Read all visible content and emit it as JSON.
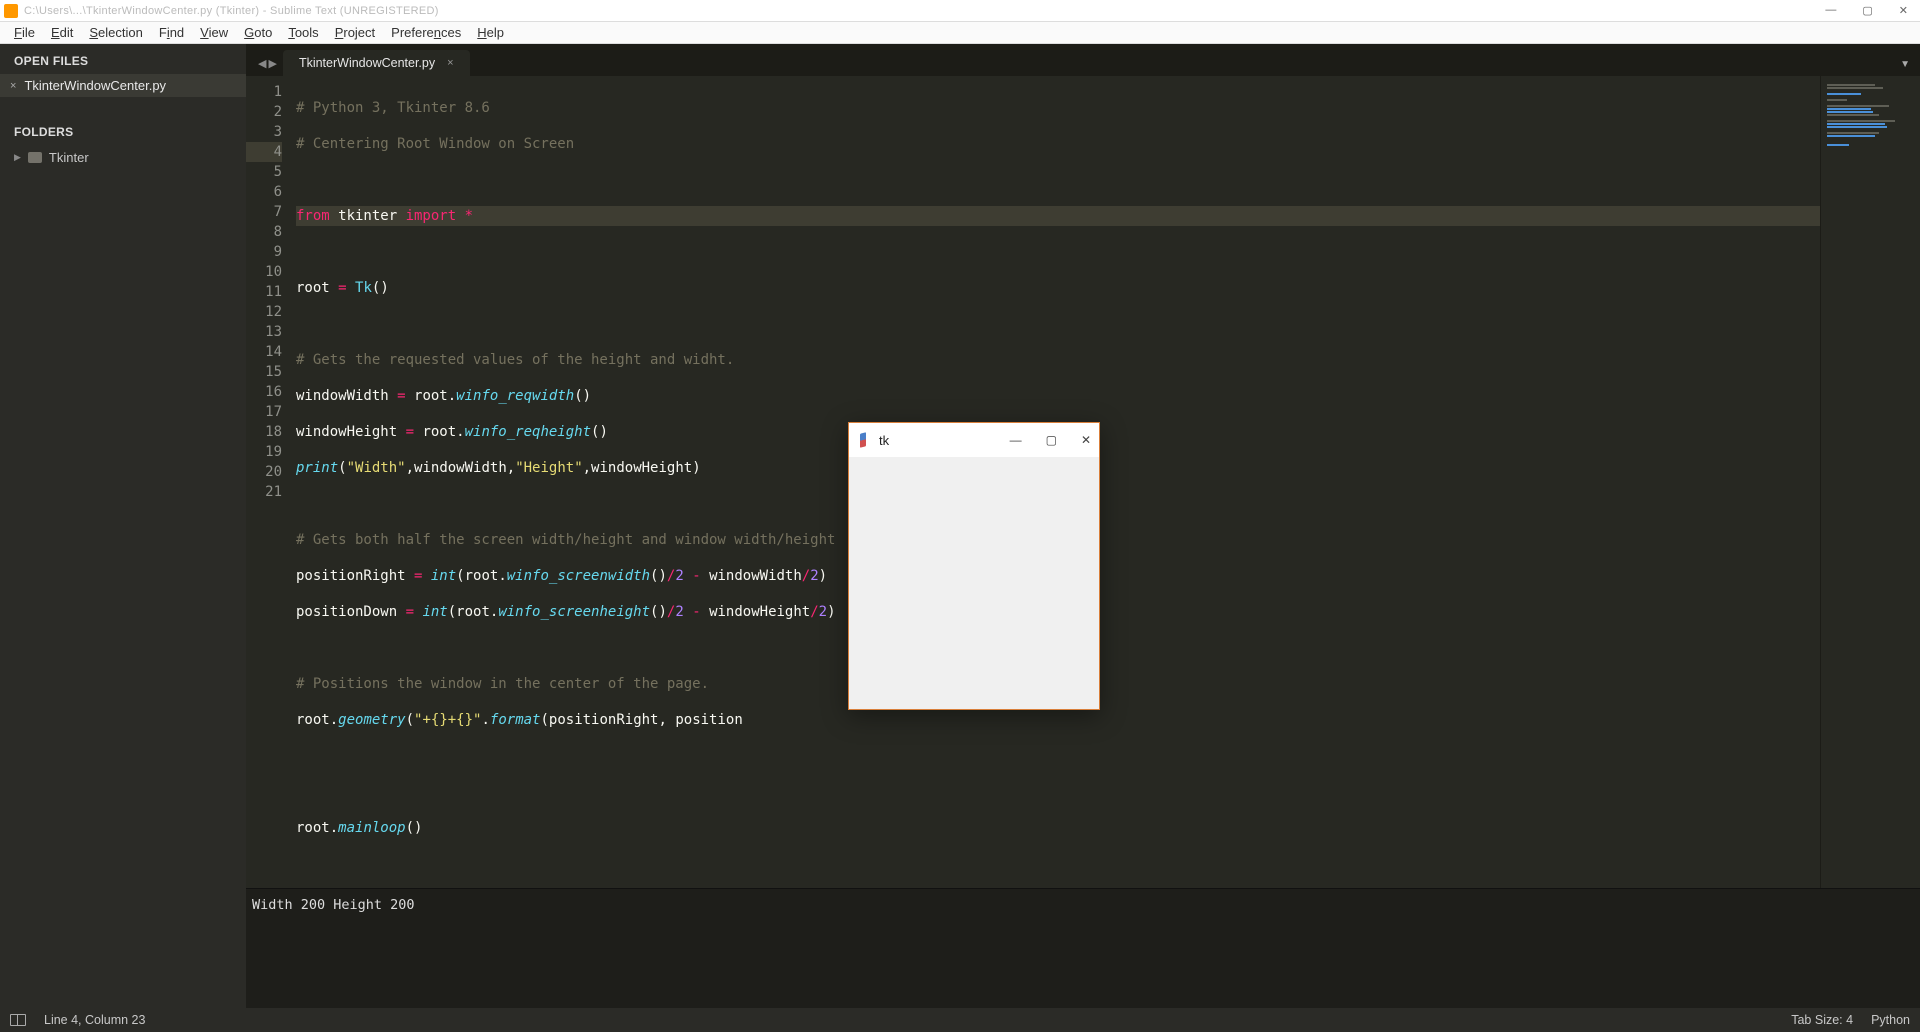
{
  "window": {
    "title": "C:\\Users\\...\\TkinterWindowCenter.py (Tkinter) - Sublime Text (UNREGISTERED)"
  },
  "menus": [
    "File",
    "Edit",
    "Selection",
    "Find",
    "View",
    "Goto",
    "Tools",
    "Project",
    "Preferences",
    "Help"
  ],
  "sidebar": {
    "open_files_hdr": "OPEN FILES",
    "open_file": {
      "name": "TkinterWindowCenter.py"
    },
    "folders_hdr": "FOLDERS",
    "folder": {
      "name": "Tkinter"
    }
  },
  "tab": {
    "label": "TkinterWindowCenter.py"
  },
  "gutter": {
    "count": 21,
    "highlight": 4
  },
  "code": {
    "l1": "# Python 3, Tkinter 8.6",
    "l2": "# Centering Root Window on Screen",
    "l4_from": "from",
    "l4_tk": " tkinter ",
    "l4_import": "import",
    "l4_star": " *",
    "l6_root": "root ",
    "l6_eq": "=",
    "l6_tk": " Tk",
    "l6_par": "()",
    "l8": "# Gets the requested values of the height and widht.",
    "l9a": "windowWidth ",
    "l9eq": "=",
    "l9b": " root.",
    "l9fn": "winfo_reqwidth",
    "l9p": "()",
    "l10a": "windowHeight ",
    "l10eq": "=",
    "l10b": " root.",
    "l10fn": "winfo_reqheight",
    "l10p": "()",
    "l11fn": "print",
    "l11a": "(",
    "l11s1": "\"Width\"",
    "l11c1": ",windowWidth,",
    "l11s2": "\"Height\"",
    "l11c2": ",windowHeight)",
    "l13": "# Gets both half the screen width/height and window width/height",
    "l14a": "positionRight ",
    "l14eq": "=",
    "l14int": " int",
    "l14b": "(root.",
    "l14fn": "winfo_screenwidth",
    "l14c": "()",
    "l14op1": "/",
    "l14n1": "2",
    "l14op2": " - ",
    "l14d": "windowWidth",
    "l14op3": "/",
    "l14n2": "2",
    "l14e": ")",
    "l15a": "positionDown ",
    "l15eq": "=",
    "l15int": " int",
    "l15b": "(root.",
    "l15fn": "winfo_screenheight",
    "l15c": "()",
    "l15op1": "/",
    "l15n1": "2",
    "l15op2": " - ",
    "l15d": "windowHeight",
    "l15op3": "/",
    "l15n2": "2",
    "l15e": ")",
    "l17": "# Positions the window in the center of the page.",
    "l18a": "root.",
    "l18fn": "geometry",
    "l18b": "(",
    "l18s": "\"+{}+{}\"",
    "l18c": ".",
    "l18fmt": "format",
    "l18d": "(positionRight, position",
    "l21a": "root.",
    "l21fn": "mainloop",
    "l21b": "()"
  },
  "console": {
    "output": "Width 200 Height 200"
  },
  "status": {
    "pos": "Line 4, Column 23",
    "tabsize": "Tab Size: 4",
    "lang": "Python"
  },
  "tk": {
    "title": "tk"
  }
}
